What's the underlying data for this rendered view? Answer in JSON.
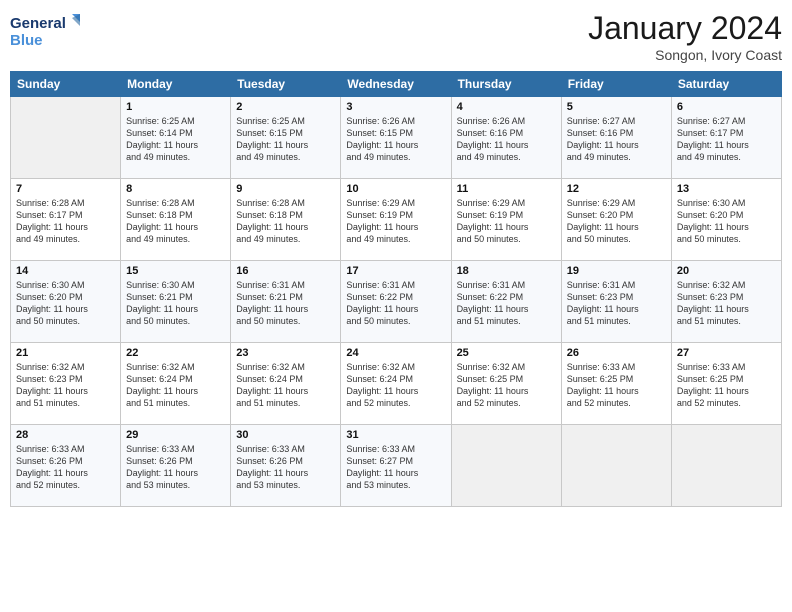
{
  "header": {
    "logo_line1": "General",
    "logo_line2": "Blue",
    "month": "January 2024",
    "location": "Songon, Ivory Coast"
  },
  "weekdays": [
    "Sunday",
    "Monday",
    "Tuesday",
    "Wednesday",
    "Thursday",
    "Friday",
    "Saturday"
  ],
  "weeks": [
    [
      {
        "day": "",
        "info": ""
      },
      {
        "day": "1",
        "info": "Sunrise: 6:25 AM\nSunset: 6:14 PM\nDaylight: 11 hours\nand 49 minutes."
      },
      {
        "day": "2",
        "info": "Sunrise: 6:25 AM\nSunset: 6:15 PM\nDaylight: 11 hours\nand 49 minutes."
      },
      {
        "day": "3",
        "info": "Sunrise: 6:26 AM\nSunset: 6:15 PM\nDaylight: 11 hours\nand 49 minutes."
      },
      {
        "day": "4",
        "info": "Sunrise: 6:26 AM\nSunset: 6:16 PM\nDaylight: 11 hours\nand 49 minutes."
      },
      {
        "day": "5",
        "info": "Sunrise: 6:27 AM\nSunset: 6:16 PM\nDaylight: 11 hours\nand 49 minutes."
      },
      {
        "day": "6",
        "info": "Sunrise: 6:27 AM\nSunset: 6:17 PM\nDaylight: 11 hours\nand 49 minutes."
      }
    ],
    [
      {
        "day": "7",
        "info": "Sunrise: 6:28 AM\nSunset: 6:17 PM\nDaylight: 11 hours\nand 49 minutes."
      },
      {
        "day": "8",
        "info": "Sunrise: 6:28 AM\nSunset: 6:18 PM\nDaylight: 11 hours\nand 49 minutes."
      },
      {
        "day": "9",
        "info": "Sunrise: 6:28 AM\nSunset: 6:18 PM\nDaylight: 11 hours\nand 49 minutes."
      },
      {
        "day": "10",
        "info": "Sunrise: 6:29 AM\nSunset: 6:19 PM\nDaylight: 11 hours\nand 49 minutes."
      },
      {
        "day": "11",
        "info": "Sunrise: 6:29 AM\nSunset: 6:19 PM\nDaylight: 11 hours\nand 50 minutes."
      },
      {
        "day": "12",
        "info": "Sunrise: 6:29 AM\nSunset: 6:20 PM\nDaylight: 11 hours\nand 50 minutes."
      },
      {
        "day": "13",
        "info": "Sunrise: 6:30 AM\nSunset: 6:20 PM\nDaylight: 11 hours\nand 50 minutes."
      }
    ],
    [
      {
        "day": "14",
        "info": "Sunrise: 6:30 AM\nSunset: 6:20 PM\nDaylight: 11 hours\nand 50 minutes."
      },
      {
        "day": "15",
        "info": "Sunrise: 6:30 AM\nSunset: 6:21 PM\nDaylight: 11 hours\nand 50 minutes."
      },
      {
        "day": "16",
        "info": "Sunrise: 6:31 AM\nSunset: 6:21 PM\nDaylight: 11 hours\nand 50 minutes."
      },
      {
        "day": "17",
        "info": "Sunrise: 6:31 AM\nSunset: 6:22 PM\nDaylight: 11 hours\nand 50 minutes."
      },
      {
        "day": "18",
        "info": "Sunrise: 6:31 AM\nSunset: 6:22 PM\nDaylight: 11 hours\nand 51 minutes."
      },
      {
        "day": "19",
        "info": "Sunrise: 6:31 AM\nSunset: 6:23 PM\nDaylight: 11 hours\nand 51 minutes."
      },
      {
        "day": "20",
        "info": "Sunrise: 6:32 AM\nSunset: 6:23 PM\nDaylight: 11 hours\nand 51 minutes."
      }
    ],
    [
      {
        "day": "21",
        "info": "Sunrise: 6:32 AM\nSunset: 6:23 PM\nDaylight: 11 hours\nand 51 minutes."
      },
      {
        "day": "22",
        "info": "Sunrise: 6:32 AM\nSunset: 6:24 PM\nDaylight: 11 hours\nand 51 minutes."
      },
      {
        "day": "23",
        "info": "Sunrise: 6:32 AM\nSunset: 6:24 PM\nDaylight: 11 hours\nand 51 minutes."
      },
      {
        "day": "24",
        "info": "Sunrise: 6:32 AM\nSunset: 6:24 PM\nDaylight: 11 hours\nand 52 minutes."
      },
      {
        "day": "25",
        "info": "Sunrise: 6:32 AM\nSunset: 6:25 PM\nDaylight: 11 hours\nand 52 minutes."
      },
      {
        "day": "26",
        "info": "Sunrise: 6:33 AM\nSunset: 6:25 PM\nDaylight: 11 hours\nand 52 minutes."
      },
      {
        "day": "27",
        "info": "Sunrise: 6:33 AM\nSunset: 6:25 PM\nDaylight: 11 hours\nand 52 minutes."
      }
    ],
    [
      {
        "day": "28",
        "info": "Sunrise: 6:33 AM\nSunset: 6:26 PM\nDaylight: 11 hours\nand 52 minutes."
      },
      {
        "day": "29",
        "info": "Sunrise: 6:33 AM\nSunset: 6:26 PM\nDaylight: 11 hours\nand 53 minutes."
      },
      {
        "day": "30",
        "info": "Sunrise: 6:33 AM\nSunset: 6:26 PM\nDaylight: 11 hours\nand 53 minutes."
      },
      {
        "day": "31",
        "info": "Sunrise: 6:33 AM\nSunset: 6:27 PM\nDaylight: 11 hours\nand 53 minutes."
      },
      {
        "day": "",
        "info": ""
      },
      {
        "day": "",
        "info": ""
      },
      {
        "day": "",
        "info": ""
      }
    ]
  ]
}
